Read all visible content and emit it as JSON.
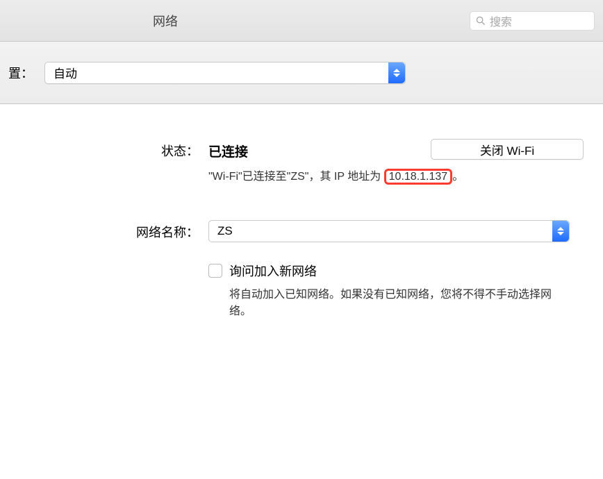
{
  "titlebar": {
    "title": "网络",
    "search_placeholder": "搜索"
  },
  "toolbar": {
    "location_label": "置：",
    "location_value": "自动"
  },
  "status": {
    "label": "状态：",
    "value": "已连接",
    "turn_off_label": "关闭 Wi-Fi",
    "desc_prefix": "\"Wi-Fi\"已连接至\"ZS\"，其 IP 地址为",
    "ip": "10.18.1.137",
    "desc_suffix": "。"
  },
  "network_name": {
    "label": "网络名称：",
    "value": "ZS"
  },
  "ask_join": {
    "label": "询问加入新网络",
    "helper": "将自动加入已知网络。如果没有已知网络，您将不得不手动选择网络。"
  }
}
